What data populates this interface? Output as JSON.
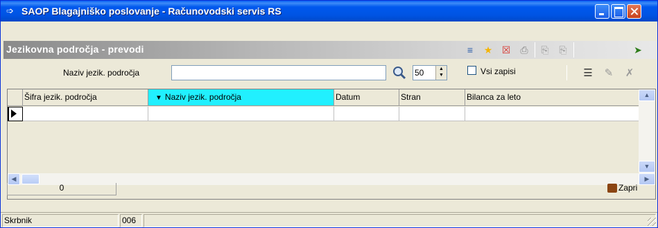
{
  "window": {
    "title": "SAOP Blagajniško poslovanje - Računovodski servis RS"
  },
  "panel": {
    "title": "Jezikovna področja - prevodi",
    "icons": [
      "list-icon",
      "star-icon",
      "delete-icon",
      "print-icon",
      "copy-icon",
      "paste-icon",
      "exit-icon"
    ]
  },
  "search": {
    "label": "Naziv jezik. področja",
    "value": "",
    "page_size": "50",
    "all_records_label": "Vsi zapisi",
    "all_records_checked": false
  },
  "grid": {
    "columns": [
      "Šifra jezik. področja",
      "Naziv jezik. področja",
      "Datum",
      "Stran",
      "Bilanca za leto"
    ],
    "sorted_column": 1,
    "rows": [
      [
        "",
        "",
        "",
        "",
        ""
      ]
    ]
  },
  "footer": {
    "cell_value": "0",
    "close_label": "Zapri"
  },
  "status": {
    "label": "Skrbnik",
    "value": "006"
  },
  "colors": {
    "titlebar": "#0054e3",
    "sorted_header": "#21f0ff"
  }
}
